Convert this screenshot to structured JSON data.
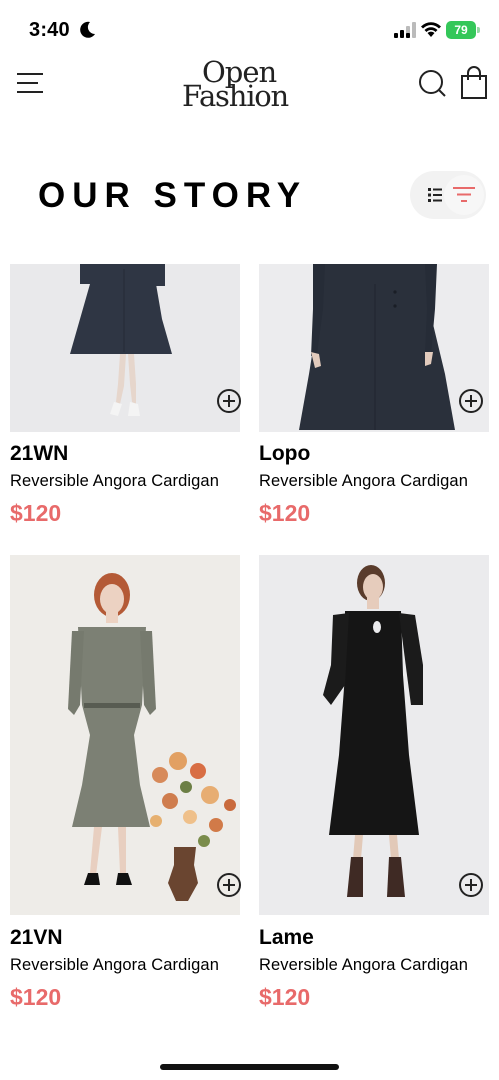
{
  "status_bar": {
    "time": "3:40",
    "battery": "79",
    "icons": [
      "moon-icon",
      "signal-icon",
      "wifi-icon",
      "battery-icon"
    ]
  },
  "header": {
    "logo_top": "Open",
    "logo_bottom": "Fashion",
    "icons": [
      "menu-icon",
      "search-icon",
      "shopping-bag-icon"
    ]
  },
  "page": {
    "title": "OUR STORY",
    "view_icons": [
      "list-view-icon",
      "filter-icon"
    ]
  },
  "colors": {
    "price": "#e86a6a",
    "accent": "#e86a6a",
    "text": "#000000",
    "toggle_bg": "#f2f2f2"
  },
  "products": [
    {
      "name": "21WN",
      "description": "Reversible Angora Cardigan",
      "price": "$120",
      "icon": "add-circle-icon"
    },
    {
      "name": "Lopo",
      "description": "Reversible Angora Cardigan",
      "price": "$120",
      "icon": "add-circle-icon"
    },
    {
      "name": "21VN",
      "description": "Reversible Angora Cardigan",
      "price": "$120",
      "icon": "add-circle-icon"
    },
    {
      "name": "Lame",
      "description": "Reversible Angora Cardigan",
      "price": "$120",
      "icon": "add-circle-icon"
    }
  ]
}
